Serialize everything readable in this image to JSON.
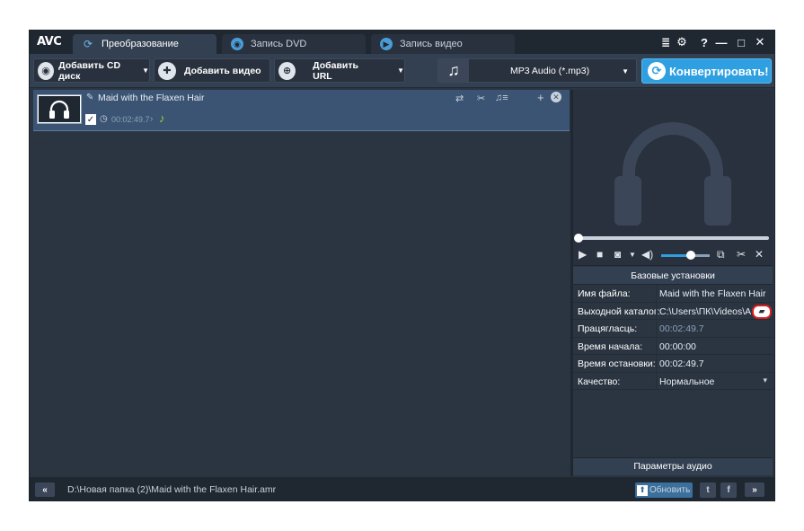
{
  "app": {
    "logo": "AVC",
    "tabs": [
      {
        "label": "Преобразование",
        "icon": "convert-icon",
        "active": true
      },
      {
        "label": "Запись DVD",
        "icon": "disc-icon",
        "active": false
      },
      {
        "label": "Запись видео",
        "icon": "play-icon",
        "active": false
      }
    ],
    "window_controls": {
      "menu": "≣",
      "settings": "⚙",
      "help": "?",
      "minimize": "—",
      "maximize": "□",
      "close": "✕"
    }
  },
  "toolbar": {
    "add_cd": "Добавить CD диск",
    "add_video": "Добавить видео",
    "add_url": "Добавить URL",
    "format": "MP3 Audio (*.mp3)",
    "convert": "Конвертировать!"
  },
  "file": {
    "name": "Maid with the Flaxen Hair",
    "duration": "00:02:49.7",
    "checked": true
  },
  "properties": {
    "header": "Базовые установки",
    "rows": [
      {
        "label": "Имя файла:",
        "value": "Maid with the Flaxen Hair"
      },
      {
        "label": "Выходной каталог:",
        "value": "C:\\Users\\ПК\\Videos\\Any Video Converter"
      },
      {
        "label": "Працягласць:",
        "value": "00:02:49.7"
      },
      {
        "label": "Время начала:",
        "value": "00:00:00"
      },
      {
        "label": "Время остановки:",
        "value": "00:02:49.7"
      },
      {
        "label": "Качество:",
        "value": "Нормальное"
      }
    ],
    "audio_params": "Параметры аудио"
  },
  "player": {
    "seek_fraction": 0.0,
    "volume_fraction": 0.62
  },
  "statusbar": {
    "collapse": "«",
    "path": "D:\\Новая папка (2)\\Maid with the Flaxen Hair.amr",
    "update": "Обновить",
    "twitter": "t",
    "facebook": "f",
    "expand": "»"
  },
  "colors": {
    "accent": "#2e9fe0",
    "window_bg": "#2b3542",
    "selected_row": "#3b5473",
    "highlight_ring": "#d81e1e"
  }
}
